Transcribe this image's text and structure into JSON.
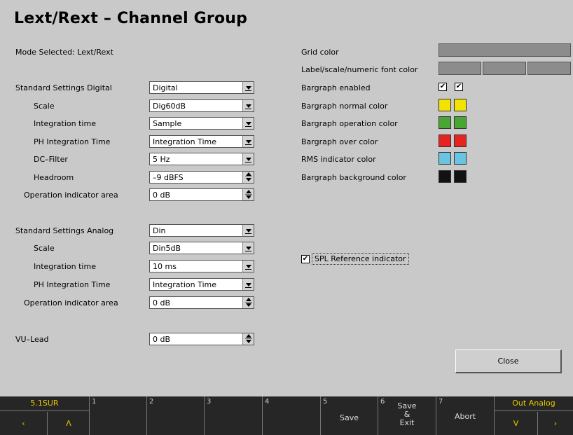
{
  "title": "Lext/Rext – Channel Group",
  "mode_selected": "Mode Selected: Lext/Rext",
  "digital": {
    "header": "Standard Settings Digital",
    "header_value": "Digital",
    "scale_label": "Scale",
    "scale_value": "Dig60dB",
    "integration_label": "Integration time",
    "integration_value": "Sample",
    "ph_label": "PH Integration Time",
    "ph_value": "Integration Time",
    "dc_label": "DC–Filter",
    "dc_value": "5 Hz",
    "headroom_label": "Headroom",
    "headroom_value": "–9 dBFS",
    "opind_label": "Operation indicator area",
    "opind_value": "0 dB"
  },
  "analog": {
    "header": "Standard Settings Analog",
    "header_value": "Din",
    "scale_label": "Scale",
    "scale_value": "Din5dB",
    "integration_label": "Integration time",
    "integration_value": "10 ms",
    "ph_label": "PH Integration Time",
    "ph_value": "Integration Time",
    "opind_label": "Operation indicator area",
    "opind_value": "0 dB"
  },
  "vu": {
    "label": "VU–Lead",
    "value": "0 dB"
  },
  "right": {
    "grid_color": "Grid color",
    "font_color": "Label/scale/numeric font color",
    "bargraph_enabled": "Bargraph enabled",
    "normal_color": "Bargraph normal color",
    "operation_color": "Bargraph operation color",
    "over_color": "Bargraph over color",
    "rms_color": "RMS indicator color",
    "background_color": "Bargraph background color",
    "spl_label": "SPL Reference indicator"
  },
  "checks": {
    "bargraph_1": "✔",
    "bargraph_2": "✔",
    "spl": "✔"
  },
  "colors": {
    "normal": "#f4e200",
    "operation": "#4aa632",
    "over": "#e52420",
    "rms": "#68c4e0",
    "background": "#121212",
    "grid": "#8c8c8c",
    "footer_accent": "#e8c800"
  },
  "close_label": "Close",
  "footer": {
    "k0_top": "5.1SUR",
    "k0_left": "‹",
    "k0_right": "Λ",
    "k1_num": "1",
    "k2_num": "2",
    "k3_num": "3",
    "k4_num": "4",
    "k5_num": "5",
    "k5_label": "Save",
    "k6_num": "6",
    "k6_line1": "Save",
    "k6_line2": "&",
    "k6_line3": "Exit",
    "k7_num": "7",
    "k7_label": "Abort",
    "k8_top": "Out Analog",
    "k8_left": "V",
    "k8_right": "›"
  }
}
